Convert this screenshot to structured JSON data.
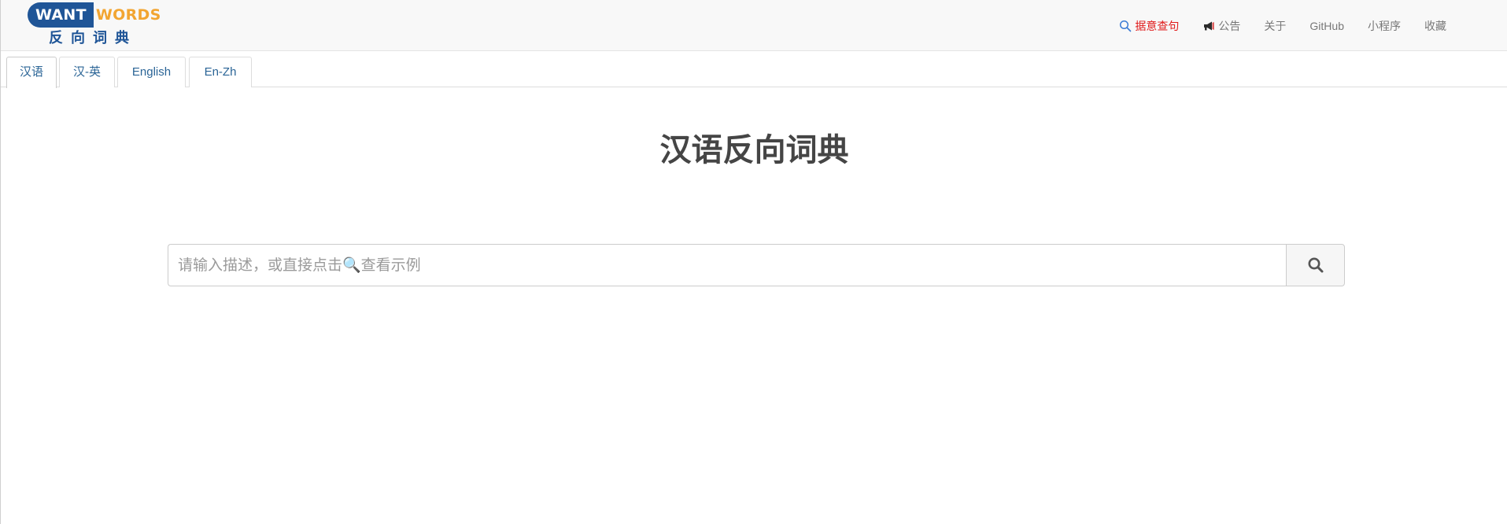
{
  "logo": {
    "want": "WANT",
    "words": "WORDS",
    "subtitle": "反向词典"
  },
  "nav": {
    "items": [
      {
        "label": "据意查句",
        "icon": "search-icon",
        "active": true,
        "color": "#e01b1b"
      },
      {
        "label": "公告",
        "icon": "megaphone-icon",
        "active": false
      },
      {
        "label": "关于",
        "active": false
      },
      {
        "label": "GitHub",
        "active": false
      },
      {
        "label": "小程序",
        "active": false
      },
      {
        "label": "收藏",
        "active": false
      }
    ]
  },
  "tabs": [
    {
      "label": "汉语",
      "active": true
    },
    {
      "label": "汉-英",
      "active": false
    },
    {
      "label": "English",
      "active": false
    },
    {
      "label": "En-Zh",
      "active": false
    }
  ],
  "main": {
    "title": "汉语反向词典"
  },
  "search": {
    "placeholder": "请输入描述，或直接点击🔍查看示例",
    "value": "",
    "button_icon": "search-icon"
  },
  "colors": {
    "brand_blue": "#1f5597",
    "brand_orange": "#f2a531",
    "tab_text": "#2a6496",
    "active_nav": "#e01b1b"
  }
}
